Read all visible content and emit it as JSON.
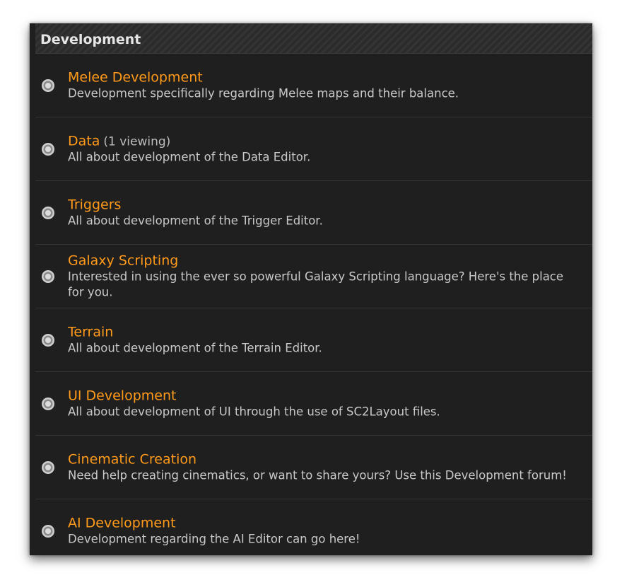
{
  "section": {
    "title": "Development"
  },
  "forums": [
    {
      "title": "Melee Development",
      "viewing": "",
      "description": "Development specifically regarding Melee maps and their balance.",
      "icon": "forum-bullet-icon"
    },
    {
      "title": "Data",
      "viewing": "(1 viewing)",
      "description": "All about development of the Data Editor.",
      "icon": "forum-bullet-icon"
    },
    {
      "title": "Triggers",
      "viewing": "",
      "description": "All about development of the Trigger Editor.",
      "icon": "forum-bullet-icon"
    },
    {
      "title": "Galaxy Scripting",
      "viewing": "",
      "description": "Interested in using the ever so powerful Galaxy Scripting language? Here's the place for you.",
      "icon": "forum-bullet-icon"
    },
    {
      "title": "Terrain",
      "viewing": "",
      "description": "All about development of the Terrain Editor.",
      "icon": "forum-bullet-icon"
    },
    {
      "title": "UI Development",
      "viewing": "",
      "description": "All about development of UI through the use of SC2Layout files.",
      "icon": "forum-bullet-icon"
    },
    {
      "title": "Cinematic Creation",
      "viewing": "",
      "description": "Need help creating cinematics, or want to share yours? Use this Development forum!",
      "icon": "forum-bullet-icon"
    },
    {
      "title": "AI Development",
      "viewing": "",
      "description": "Development regarding the AI Editor can go here!",
      "icon": "forum-bullet-icon"
    }
  ],
  "colors": {
    "link": "#ff9a1a",
    "panel_bg": "#1f1f1f",
    "text": "#c9c9c9"
  }
}
